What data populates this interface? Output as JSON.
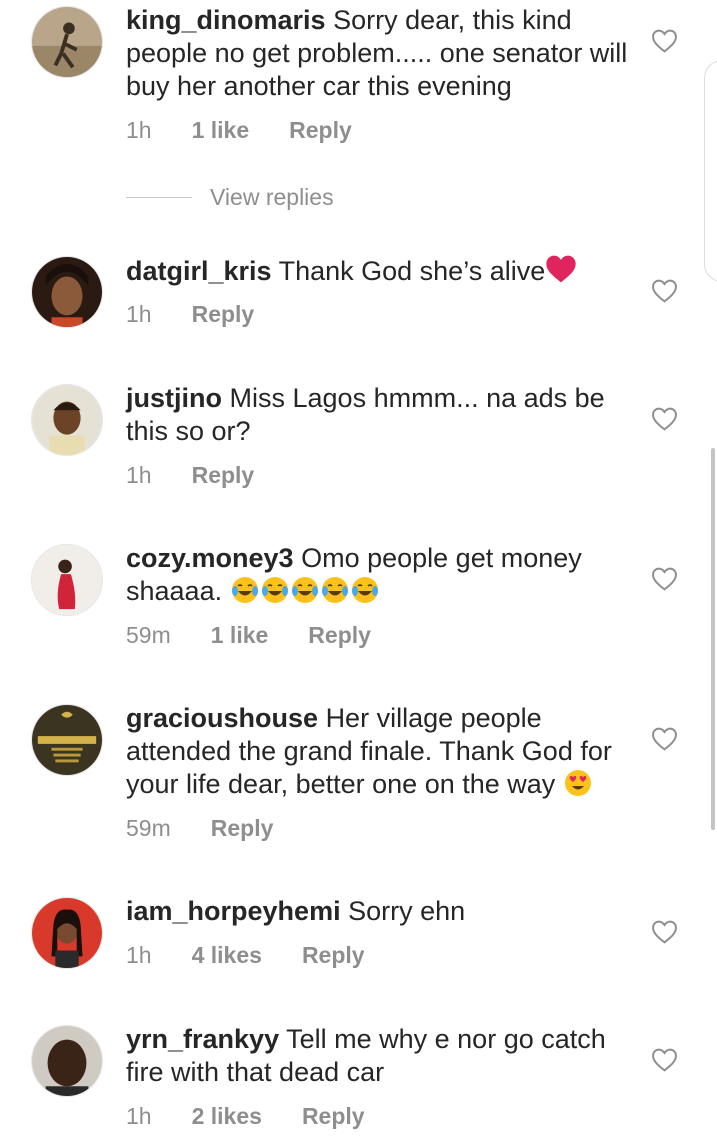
{
  "comments": [
    {
      "username": "king_dinomaris",
      "text": "Sorry dear, this kind people no get problem..... one senator will buy her another car this evening",
      "time": "1h",
      "likes": "1 like",
      "reply": "Reply"
    },
    {
      "username": "datgirl_kris",
      "text": "Thank God she’s alive",
      "time": "1h",
      "likes": "",
      "reply": "Reply"
    },
    {
      "username": "justjino",
      "text": "Miss Lagos hmmm... na ads be this so or?",
      "time": "1h",
      "likes": "",
      "reply": "Reply"
    },
    {
      "username": "cozy.money3",
      "text": "Omo people get money shaaaa.",
      "time": "59m",
      "likes": "1 like",
      "reply": "Reply"
    },
    {
      "username": "gracioushouse",
      "text": "Her village people attended the grand finale. Thank God for your life dear, better one on the way",
      "time": "59m",
      "likes": "",
      "reply": "Reply"
    },
    {
      "username": "iam_horpeyhemi",
      "text": "Sorry ehn",
      "time": "1h",
      "likes": "4 likes",
      "reply": "Reply"
    },
    {
      "username": "yrn_frankyy",
      "text": "Tell me why e nor go catch fire with that dead car",
      "time": "1h",
      "likes": "2 likes",
      "reply": "Reply"
    }
  ],
  "view_replies": "View replies",
  "icons": {
    "like": "heart-outline-icon",
    "red_heart": "red-heart-emoji",
    "laugh": "tears-of-joy-emoji",
    "heart_eyes": "heart-eyes-emoji"
  },
  "colors": {
    "text": "#262626",
    "meta": "#8e8e8e",
    "heart_red": "#e0245e"
  }
}
